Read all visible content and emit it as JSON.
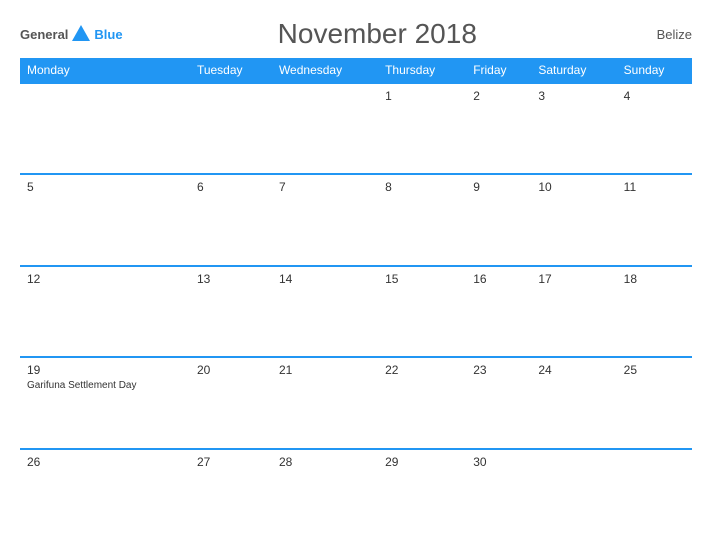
{
  "logo": {
    "general": "General",
    "blue": "Blue"
  },
  "title": "November 2018",
  "country": "Belize",
  "days_of_week": [
    "Monday",
    "Tuesday",
    "Wednesday",
    "Thursday",
    "Friday",
    "Saturday",
    "Sunday"
  ],
  "weeks": [
    [
      {
        "day": "",
        "holiday": ""
      },
      {
        "day": "",
        "holiday": ""
      },
      {
        "day": "",
        "holiday": ""
      },
      {
        "day": "1",
        "holiday": ""
      },
      {
        "day": "2",
        "holiday": ""
      },
      {
        "day": "3",
        "holiday": ""
      },
      {
        "day": "4",
        "holiday": ""
      }
    ],
    [
      {
        "day": "5",
        "holiday": ""
      },
      {
        "day": "6",
        "holiday": ""
      },
      {
        "day": "7",
        "holiday": ""
      },
      {
        "day": "8",
        "holiday": ""
      },
      {
        "day": "9",
        "holiday": ""
      },
      {
        "day": "10",
        "holiday": ""
      },
      {
        "day": "11",
        "holiday": ""
      }
    ],
    [
      {
        "day": "12",
        "holiday": ""
      },
      {
        "day": "13",
        "holiday": ""
      },
      {
        "day": "14",
        "holiday": ""
      },
      {
        "day": "15",
        "holiday": ""
      },
      {
        "day": "16",
        "holiday": ""
      },
      {
        "day": "17",
        "holiday": ""
      },
      {
        "day": "18",
        "holiday": ""
      }
    ],
    [
      {
        "day": "19",
        "holiday": "Garifuna Settlement Day"
      },
      {
        "day": "20",
        "holiday": ""
      },
      {
        "day": "21",
        "holiday": ""
      },
      {
        "day": "22",
        "holiday": ""
      },
      {
        "day": "23",
        "holiday": ""
      },
      {
        "day": "24",
        "holiday": ""
      },
      {
        "day": "25",
        "holiday": ""
      }
    ],
    [
      {
        "day": "26",
        "holiday": ""
      },
      {
        "day": "27",
        "holiday": ""
      },
      {
        "day": "28",
        "holiday": ""
      },
      {
        "day": "29",
        "holiday": ""
      },
      {
        "day": "30",
        "holiday": ""
      },
      {
        "day": "",
        "holiday": ""
      },
      {
        "day": "",
        "holiday": ""
      }
    ]
  ]
}
